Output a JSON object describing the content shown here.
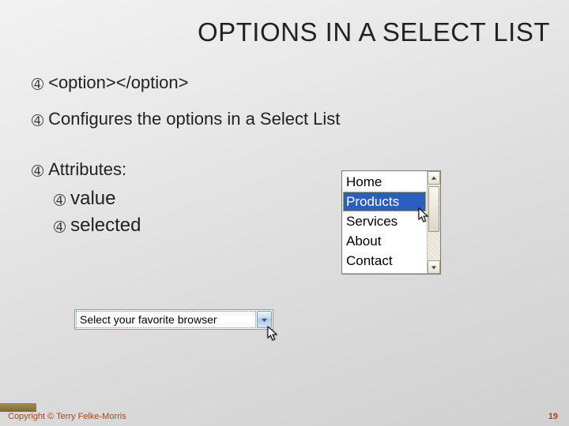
{
  "title": "OPTIONS IN A SELECT LIST",
  "bullets": {
    "b1": "<option></option>",
    "b2": "Configures the options in a Select List",
    "b3": "Attributes:",
    "sub1": "value",
    "sub2": "selected"
  },
  "listbox": {
    "items": [
      "Home",
      "Products",
      "Services",
      "About",
      "Contact"
    ],
    "selected_index": 1
  },
  "dropdown": {
    "text": "Select your favorite browser"
  },
  "footer": "Copyright © Terry Felke-Morris",
  "page": "19",
  "marker": "➃"
}
